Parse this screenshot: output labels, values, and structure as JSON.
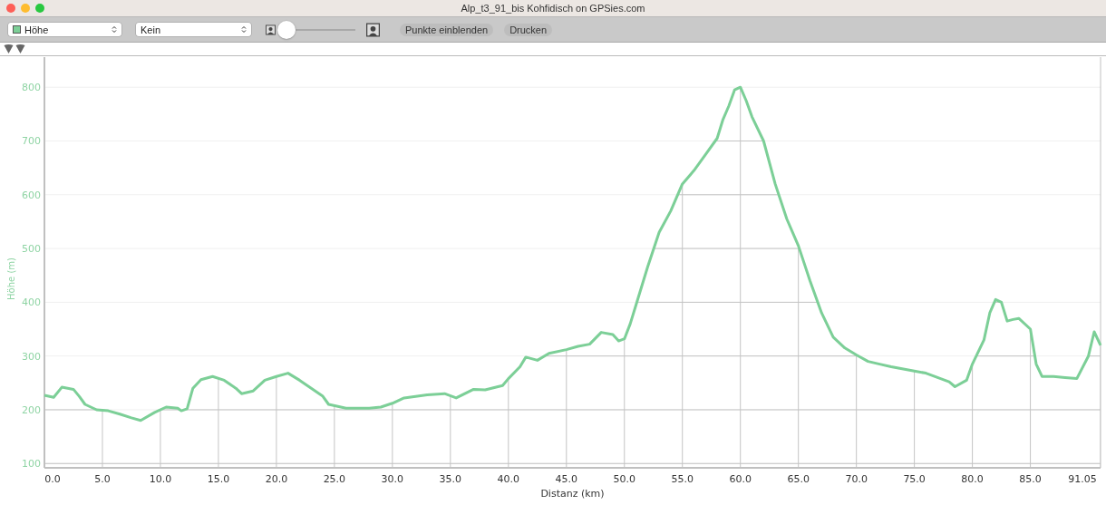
{
  "window": {
    "title": "Alp_t3_91_bis Kohfidisch on GPSies.com"
  },
  "toolbar": {
    "dataset_select": {
      "value": "Höhe",
      "color": "#7ccf97"
    },
    "overlay_select": {
      "value": "Kein"
    },
    "zoom_slider": {
      "level": 0
    },
    "buttons": [
      "Punkte einblenden",
      "Drucken"
    ]
  },
  "chart": {
    "chart_data": {
      "type": "line",
      "xlabel": "Distanz (km)",
      "ylabel": "Höhe (m)",
      "xlim": [
        0,
        91.05
      ],
      "ylim": [
        92,
        856
      ],
      "xticks": [
        {
          "value": 0,
          "label": "0.0"
        },
        {
          "value": 5,
          "label": "5.0"
        },
        {
          "value": 10,
          "label": "10.0"
        },
        {
          "value": 15,
          "label": "15.0"
        },
        {
          "value": 20,
          "label": "20.0"
        },
        {
          "value": 25,
          "label": "25.0"
        },
        {
          "value": 30,
          "label": "30.0"
        },
        {
          "value": 35,
          "label": "35.0"
        },
        {
          "value": 40,
          "label": "40.0"
        },
        {
          "value": 45,
          "label": "45.0"
        },
        {
          "value": 50,
          "label": "50.0"
        },
        {
          "value": 55,
          "label": "55.0"
        },
        {
          "value": 60,
          "label": "60.0"
        },
        {
          "value": 65,
          "label": "65.0"
        },
        {
          "value": 70,
          "label": "70.0"
        },
        {
          "value": 75,
          "label": "75.0"
        },
        {
          "value": 80,
          "label": "80.0"
        },
        {
          "value": 85,
          "label": "85.0"
        },
        {
          "value": 91.05,
          "label": "91.05"
        }
      ],
      "yticks": [
        100,
        200,
        300,
        400,
        500,
        600,
        700,
        800
      ],
      "x": [
        0,
        0.8,
        1.5,
        2.5,
        3,
        3.5,
        4.5,
        5.5,
        6.5,
        7.5,
        8.3,
        9.5,
        10.5,
        11.5,
        11.8,
        12.3,
        12.8,
        13.5,
        14.5,
        15.5,
        16.5,
        17,
        18,
        19,
        20,
        21,
        22,
        23,
        24,
        24.5,
        26,
        28,
        29,
        30,
        31,
        33,
        34.5,
        35.5,
        37,
        38,
        39.5,
        40,
        41,
        41.5,
        42.5,
        43.5,
        45,
        46,
        47,
        48,
        49,
        49.5,
        50,
        50.5,
        51,
        52,
        53,
        54,
        55,
        56,
        57,
        58,
        58.5,
        59,
        59.5,
        60,
        60.5,
        61,
        62,
        63,
        64,
        65,
        66,
        67,
        68,
        69,
        70,
        71,
        72,
        73,
        75,
        76,
        77,
        78,
        78.5,
        79.5,
        80,
        81,
        81.5,
        82,
        82.5,
        83,
        83.5,
        84,
        85,
        85.5,
        86,
        87,
        88,
        89,
        90,
        90.5,
        91.05
      ],
      "grid": true,
      "series": [
        {
          "color": "#7ccf97",
          "values": [
            227,
            223,
            242,
            238,
            225,
            210,
            200,
            198,
            192,
            185,
            180,
            195,
            205,
            203,
            198,
            202,
            240,
            256,
            262,
            255,
            240,
            230,
            235,
            255,
            262,
            268,
            255,
            240,
            225,
            210,
            203,
            203,
            205,
            212,
            222,
            228,
            230,
            222,
            238,
            237,
            245,
            258,
            280,
            298,
            292,
            305,
            312,
            318,
            322,
            344,
            340,
            328,
            332,
            360,
            395,
            465,
            530,
            570,
            620,
            645,
            675,
            705,
            740,
            765,
            795,
            800,
            775,
            745,
            700,
            620,
            555,
            505,
            440,
            380,
            335,
            315,
            302,
            290,
            285,
            280,
            272,
            268,
            260,
            252,
            243,
            255,
            285,
            330,
            380,
            405,
            400,
            365,
            368,
            370,
            350,
            285,
            262,
            262,
            260,
            258,
            300,
            345,
            320
          ]
        }
      ]
    }
  }
}
